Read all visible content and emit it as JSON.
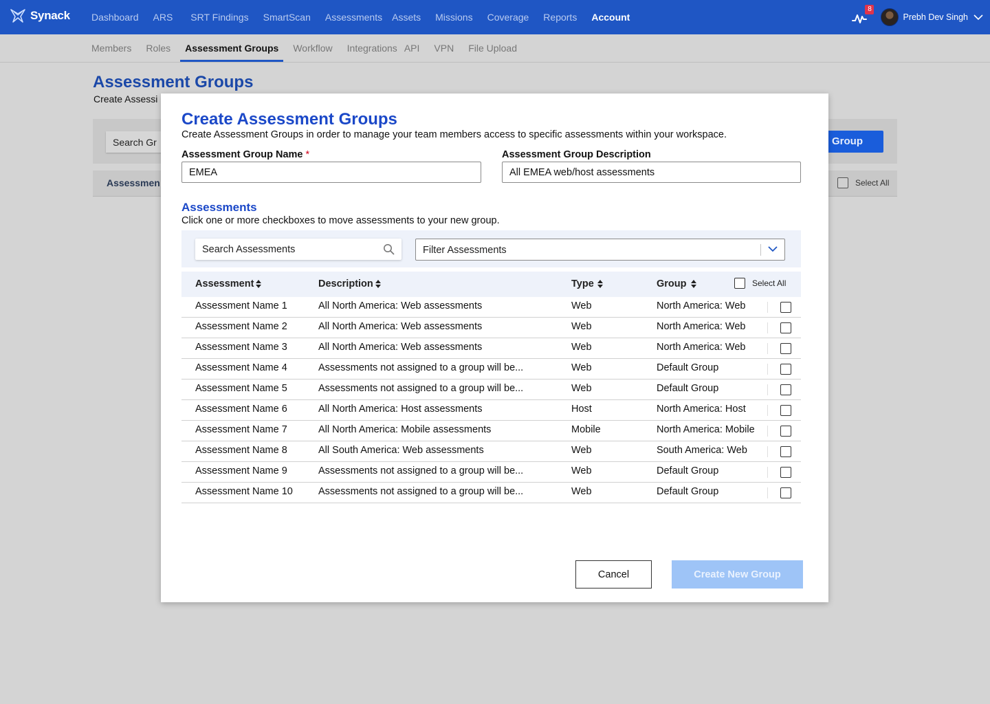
{
  "app": {
    "brand": "Synack",
    "accent": "#1f56c4"
  },
  "topnav": {
    "items": [
      "Dashboard",
      "ARS",
      "SRT Findings",
      "SmartScan",
      "Assessments",
      "Assets",
      "Missions",
      "Coverage",
      "Reports",
      "Account"
    ],
    "active": "Account",
    "notification_count": "8",
    "user_name": "Prebh Dev Singh"
  },
  "subnav": {
    "items": [
      "Members",
      "Roles",
      "Assessment Groups",
      "Workflow",
      "Integrations",
      "API",
      "VPN",
      "File Upload"
    ],
    "active": "Assessment Groups"
  },
  "background": {
    "title": "Assessment Groups",
    "subtitle": "Create Assessi",
    "search_text": "Search Gr",
    "button_label": "Group",
    "table_header": "Assessmen",
    "select_all": "Select All"
  },
  "modal": {
    "title": "Create Assessment Groups",
    "subtitle": "Create Assessment Groups in order to manage your team members access to specific assessments within your workspace.",
    "name_label": "Assessment Group Name",
    "required_mark": "*",
    "name_value": "EMEA",
    "desc_label": "Assessment Group Description",
    "desc_value": "All EMEA web/host assessments",
    "section_title": "Assessments",
    "section_sub": "Click one or more checkboxes to move assessments to your new group.",
    "search_placeholder": "Search Assessments",
    "filter_placeholder": "Filter Assessments",
    "columns": [
      "Assessment",
      "Description",
      "Type",
      "Group"
    ],
    "select_all": "Select All",
    "rows": [
      {
        "name": "Assessment Name 1",
        "description": "All North America: Web assessments",
        "type": "Web",
        "group": "North America: Web"
      },
      {
        "name": "Assessment Name 2",
        "description": "All North America: Web assessments",
        "type": "Web",
        "group": "North America: Web"
      },
      {
        "name": "Assessment Name 3",
        "description": "All North America: Web assessments",
        "type": "Web",
        "group": "North America: Web"
      },
      {
        "name": "Assessment Name 4",
        "description": "Assessments not assigned to a group will be...",
        "type": "Web",
        "group": "Default Group"
      },
      {
        "name": "Assessment Name 5",
        "description": "Assessments not assigned to a group will be...",
        "type": "Web",
        "group": "Default Group"
      },
      {
        "name": "Assessment Name 6",
        "description": "All North America: Host assessments",
        "type": "Host",
        "group": "North America: Host"
      },
      {
        "name": "Assessment Name 7",
        "description": "All North America: Mobile assessments",
        "type": "Mobile",
        "group": "North America: Mobile"
      },
      {
        "name": "Assessment Name 8",
        "description": "All South America: Web assessments",
        "type": "Web",
        "group": "South America: Web"
      },
      {
        "name": "Assessment Name 9",
        "description": "Assessments not assigned to a group will be...",
        "type": "Web",
        "group": "Default Group"
      },
      {
        "name": "Assessment Name 10",
        "description": "Assessments not assigned to a group will be...",
        "type": "Web",
        "group": "Default Group"
      }
    ],
    "cancel_label": "Cancel",
    "create_label": "Create New Group"
  }
}
